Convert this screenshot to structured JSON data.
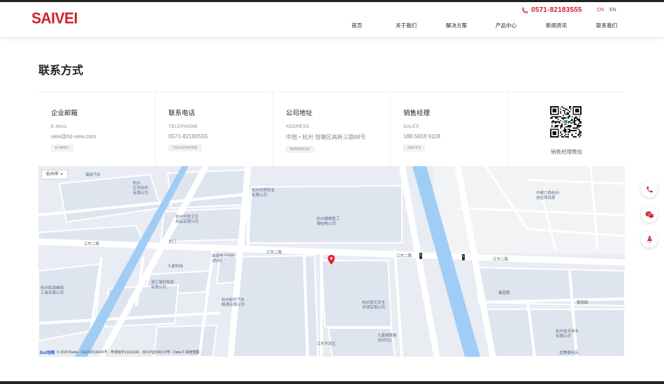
{
  "header": {
    "logo": "SAIVEI",
    "phone": "0571-82183555",
    "languages": {
      "cn": "CN",
      "en": "EN"
    },
    "nav": [
      {
        "label": "首页"
      },
      {
        "label": "关于我们"
      },
      {
        "label": "解决方案"
      },
      {
        "label": "产品中心"
      },
      {
        "label": "新闻资讯"
      },
      {
        "label": "联系我们"
      }
    ]
  },
  "page": {
    "title": "联系方式"
  },
  "contacts": [
    {
      "title": "企业邮箱",
      "label_en": "E-MAIL",
      "value": "sew@hz-sew.com",
      "tag": "E-MAIL"
    },
    {
      "title": "联系电话",
      "label_en": "TELEPHONE",
      "value": "0571-82183555",
      "tag": "TELEPHONE"
    },
    {
      "title": "公司地址",
      "label_en": "ADDRESS",
      "value": "中国 • 杭州 钱塘区高新三路88号",
      "tag": "ADDRESS"
    },
    {
      "title": "销售经理",
      "label_en": "SALES",
      "value": "188 5818 9118",
      "tag": "SALES"
    }
  ],
  "qr": {
    "caption": "销售经理微信"
  },
  "map": {
    "city_selector": "杭州市",
    "labels": {
      "poi_1": "瑞锐汽车",
      "poi_2": "杭州\n亿华纺织\n有限公司",
      "poi_3": "杭州杰明安全\n有限公司",
      "poi_4": "杭州可挑卫生\n用品有限公司",
      "poi_5": "杭州顺峰重工\n钢结构公司",
      "poi_6": "九鼎科技",
      "poi_7": "浙江瑞轩物流\n有限公司",
      "poi_8": "启锐电子科技\n(杭州)",
      "poi_9": "杭州新轩汽车\n精通有限公司",
      "poi_10": "杭州和源梯阁\n工具有限公司",
      "poi_11": "杭州蓝天安全\n环境有限公司",
      "poi_12": "九鑫钢铁板\n(杭州北)",
      "poi_13": "中建六局杭州\n技班项目部",
      "poi_14": "杭州金天商业\n有限公司",
      "poi_15": "龙腾便利店",
      "road_1": "江东二路",
      "road_2": "江东二路",
      "road_3": "江东二路",
      "road_4": "江东二路",
      "road_5": "春园路",
      "road_6": "春园路",
      "road_7": "江东开发区",
      "gate": "东门"
    },
    "copyright": "© 2023 Baidu - GS(2021)6026号 - 甲测资字11111342 - 京ICP证030173号 - Data © 百度智图",
    "baidu_logo": "Bai地图"
  },
  "colors": {
    "brand": "#d0202c",
    "map_land": "#e9ecf2",
    "map_block": "#dfe5ef",
    "river": "#9fcdf6"
  },
  "float_buttons": [
    {
      "icon": "phone-icon"
    },
    {
      "icon": "wechat-icon"
    },
    {
      "icon": "rocket-icon"
    }
  ]
}
